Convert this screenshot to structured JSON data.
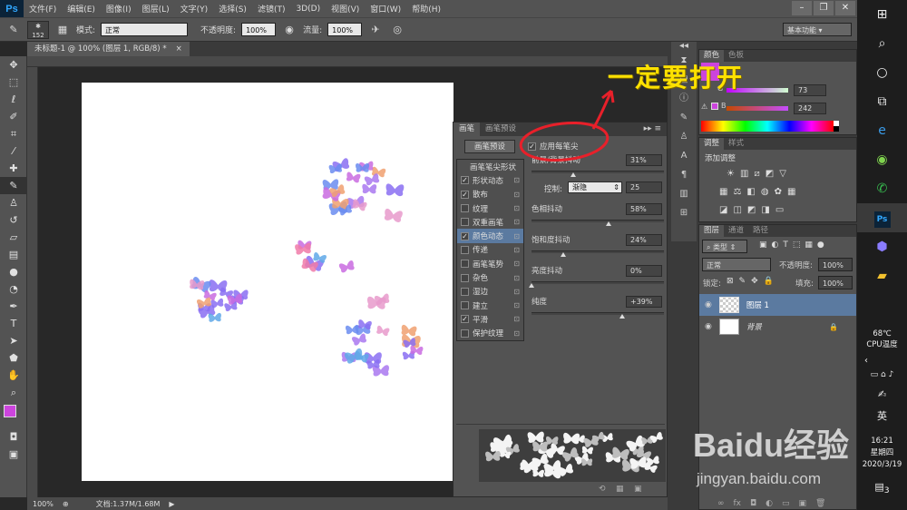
{
  "app": {
    "logo": "Ps"
  },
  "menu": [
    "文件(F)",
    "编辑(E)",
    "图像(I)",
    "图层(L)",
    "文字(Y)",
    "选择(S)",
    "滤镜(T)",
    "3D(D)",
    "视图(V)",
    "窗口(W)",
    "帮助(H)"
  ],
  "options": {
    "brush_size": "152",
    "mode_label": "模式:",
    "mode_value": "正常",
    "opacity_label": "不透明度:",
    "opacity_value": "100%",
    "flow_label": "流量:",
    "flow_value": "100%",
    "workspace": "基本功能"
  },
  "document": {
    "tab_title": "未标题-1 @ 100% (图层 1, RGB/8) *",
    "zoom": "100%",
    "doc_info": "文档:1.37M/1.68M"
  },
  "brush_panel": {
    "tabs": [
      "画笔",
      "画笔预设"
    ],
    "preset_button": "画笔预设",
    "tip_shape": "画笔笔尖形状",
    "options": [
      {
        "label": "形状动态",
        "checked": true
      },
      {
        "label": "散布",
        "checked": true
      },
      {
        "label": "纹理",
        "checked": false
      },
      {
        "label": "双重画笔",
        "checked": false
      },
      {
        "label": "颜色动态",
        "checked": true,
        "selected": true
      },
      {
        "label": "传递",
        "checked": false
      },
      {
        "label": "画笔笔势",
        "checked": false
      },
      {
        "label": "杂色",
        "checked": false
      },
      {
        "label": "湿边",
        "checked": false
      },
      {
        "label": "建立",
        "checked": false
      },
      {
        "label": "平滑",
        "checked": true
      },
      {
        "label": "保护纹理",
        "checked": false
      }
    ],
    "apply_per_tip": "应用每笔尖",
    "fg_bg_jitter_label": "前景/背景抖动",
    "fg_bg_jitter_value": "31%",
    "control_label": "控制:",
    "control_value": "渐隐",
    "control_number": "25",
    "hue_label": "色相抖动",
    "hue_value": "58%",
    "sat_label": "饱和度抖动",
    "sat_value": "24%",
    "bright_label": "亮度抖动",
    "bright_value": "0%",
    "purity_label": "纯度",
    "purity_value": "+39%"
  },
  "color_panel": {
    "tabs": [
      "颜色",
      "色板"
    ],
    "g_label": "G",
    "g_value": "73",
    "b_label": "B",
    "b_value": "242"
  },
  "adjust_panel": {
    "tabs": [
      "调整",
      "样式"
    ],
    "title": "添加调整"
  },
  "layers_panel": {
    "tabs": [
      "图层",
      "通道",
      "路径"
    ],
    "filter": "类型",
    "blend": "正常",
    "opacity_label": "不透明度:",
    "opacity_value": "100%",
    "lock_label": "锁定:",
    "fill_label": "填充:",
    "fill_value": "100%",
    "layers": [
      "图层 1",
      "背景"
    ]
  },
  "taskbar": {
    "temp": "68℃",
    "temp_label": "CPU温度",
    "lang": "英",
    "time": "16:21",
    "weekday": "星期四",
    "date": "2020/3/19",
    "notif_count": "3"
  },
  "annotation": {
    "text": "一定要打开"
  },
  "watermark": {
    "brand": "Baidu经验",
    "url": "jingyan.baidu.com"
  },
  "colors": {
    "foreground": "#cc44dd",
    "accent_annotation": "#fde100",
    "circle": "#e8202a"
  }
}
